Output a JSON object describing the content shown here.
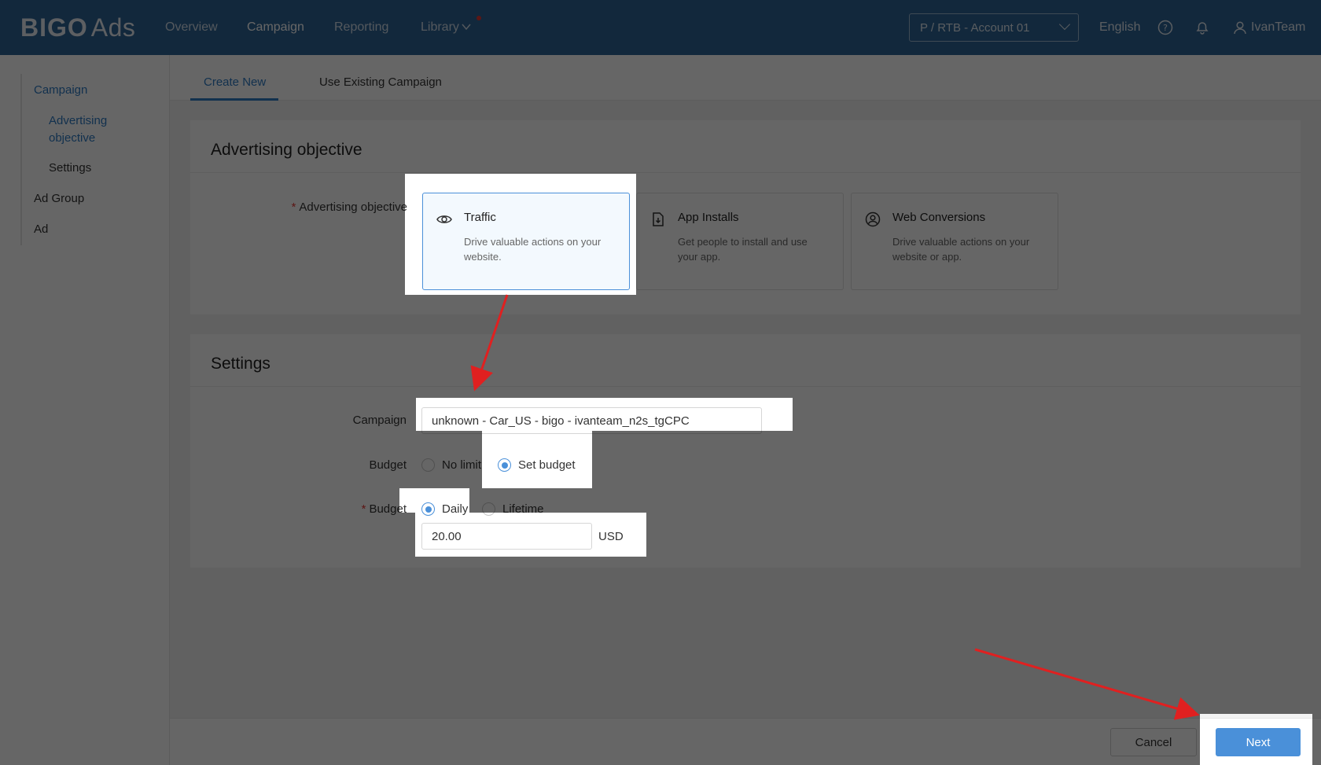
{
  "header": {
    "logo_bold": "BIGO",
    "logo_light": "Ads",
    "nav": [
      {
        "label": "Overview"
      },
      {
        "label": "Campaign"
      },
      {
        "label": "Reporting"
      },
      {
        "label": "Library"
      }
    ],
    "account": "P / RTB - Account 01",
    "language": "English",
    "user": "IvanTeam"
  },
  "sidebar": {
    "items": [
      {
        "label": "Campaign"
      },
      {
        "label": "Advertising objective"
      },
      {
        "label": "Settings"
      },
      {
        "label": "Ad Group"
      },
      {
        "label": "Ad"
      }
    ]
  },
  "tabs": [
    {
      "label": "Create New"
    },
    {
      "label": "Use Existing Campaign"
    }
  ],
  "objective_section": {
    "title": "Advertising objective",
    "field_label": "Advertising objective",
    "options": [
      {
        "title": "Traffic",
        "desc": "Drive valuable actions on your website.",
        "icon": "eye-icon",
        "selected": true
      },
      {
        "title": "App Installs",
        "desc": "Get people to install and use your app.",
        "icon": "app-install-icon",
        "selected": false
      },
      {
        "title": "Web Conversions",
        "desc": "Drive valuable actions on your website or app.",
        "icon": "user-circle-icon",
        "selected": false
      }
    ]
  },
  "settings_section": {
    "title": "Settings",
    "campaign_label": "Campaign",
    "campaign_value": "unknown - Car_US - bigo - ivanteam_n2s_tgCPC",
    "budget_label": "Budget",
    "budget_options": [
      "No limit",
      "Set budget"
    ],
    "budget_type_label": "Budget",
    "budget_type_options": [
      "Daily",
      "Lifetime"
    ],
    "budget_amount": "20.00",
    "currency": "USD"
  },
  "footer": {
    "cancel": "Cancel",
    "next": "Next"
  },
  "colors": {
    "header_bg": "#2f6596",
    "accent": "#4a90d9",
    "annotation_arrow": "#e02020"
  }
}
